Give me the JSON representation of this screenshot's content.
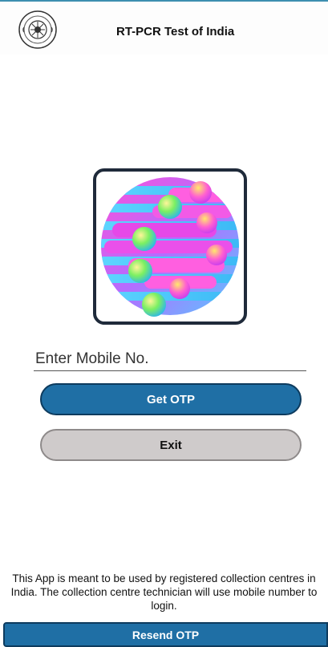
{
  "header": {
    "title": "RT-PCR Test of India",
    "emblem_icon": "icmr-emblem-icon"
  },
  "logo": {
    "icon": "rtpcr-app-logo"
  },
  "form": {
    "mobile_placeholder": "Enter Mobile No.",
    "mobile_value": "",
    "get_otp_label": "Get OTP",
    "exit_label": "Exit"
  },
  "footer": {
    "notice_lines": [
      "This App is meant to be used by registered collection centres in",
      "India. The collection centre technician will use mobile number to",
      "login."
    ],
    "resend_label": "Resend OTP"
  },
  "colors": {
    "primary": "#1f6fa5",
    "primary_border": "#0d3b5e",
    "exit_bg": "#cfcbcb",
    "logo_stripe": "#4cc9f0",
    "logo_magenta": "#f03cf0"
  }
}
